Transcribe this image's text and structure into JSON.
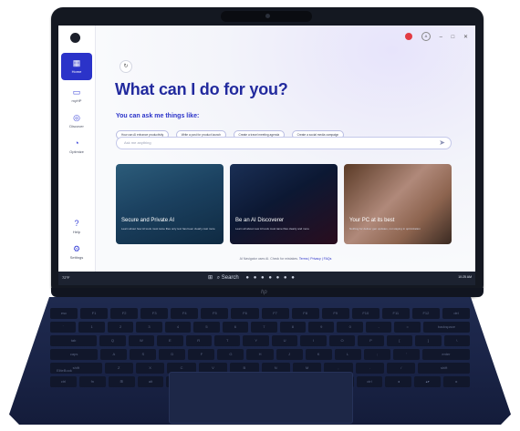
{
  "app": {
    "nav_items": [
      {
        "label": "Home",
        "icon": "grid-icon"
      },
      {
        "label": "myHP",
        "icon": "laptop-icon"
      },
      {
        "label": "Discover",
        "icon": "globe-icon"
      },
      {
        "label": "Optimize",
        "icon": "speedometer-icon"
      },
      {
        "label": "Help",
        "icon": "help-icon"
      },
      {
        "label": "Settings",
        "icon": "gear-icon"
      }
    ],
    "headline": "What can I do for you?",
    "subhead": "You can ask me things like:",
    "suggestions": [
      "How can AI enhance productivity",
      "Write a post for product launch",
      "Create a travel meeting agenda",
      "Create a social media campaign"
    ],
    "ask_placeholder": "Ask me anything",
    "cards": [
      {
        "title": "Secure and Private AI",
        "desc": "Learn about how AI tools must tame files only text has been clearly cast more"
      },
      {
        "title": "Be an AI Discoverer",
        "desc": "Learn all about new AI tools must tame files clearly and more"
      },
      {
        "title": "Your PC at its best",
        "desc": "Nothing for deliver gen updates, not staying in optimization"
      }
    ],
    "fineprint_text": "AI Navigator uses AI. Check for mistakes.",
    "fineprint_link": "Terms | Privacy | FAQs"
  },
  "taskbar": {
    "weather": "72°F",
    "search_label": "Search",
    "clock": "10:25 AM"
  },
  "laptop": {
    "logo": "hp",
    "brand": "EliteBook",
    "keys": {
      "row1": [
        "esc",
        "F1",
        "F2",
        "F3",
        "F4",
        "F5",
        "F6",
        "F7",
        "F8",
        "F9",
        "F10",
        "F11",
        "F12",
        "del"
      ],
      "row2": [
        "`",
        "1",
        "2",
        "3",
        "4",
        "5",
        "6",
        "7",
        "8",
        "9",
        "0",
        "-",
        "=",
        "backspace"
      ],
      "row3": [
        "tab",
        "Q",
        "W",
        "E",
        "R",
        "T",
        "Y",
        "U",
        "I",
        "O",
        "P",
        "[",
        "]",
        "\\"
      ],
      "row4": [
        "caps",
        "A",
        "S",
        "D",
        "F",
        "G",
        "H",
        "J",
        "K",
        "L",
        ";",
        "'",
        "enter"
      ],
      "row5": [
        "shift",
        "Z",
        "X",
        "C",
        "V",
        "B",
        "N",
        "M",
        ",",
        ".",
        "/",
        "shift"
      ],
      "row6": [
        "ctrl",
        "fn",
        "⊞",
        "alt",
        "",
        "alt",
        "ctrl",
        "◂",
        "▴▾",
        "▸"
      ]
    }
  }
}
